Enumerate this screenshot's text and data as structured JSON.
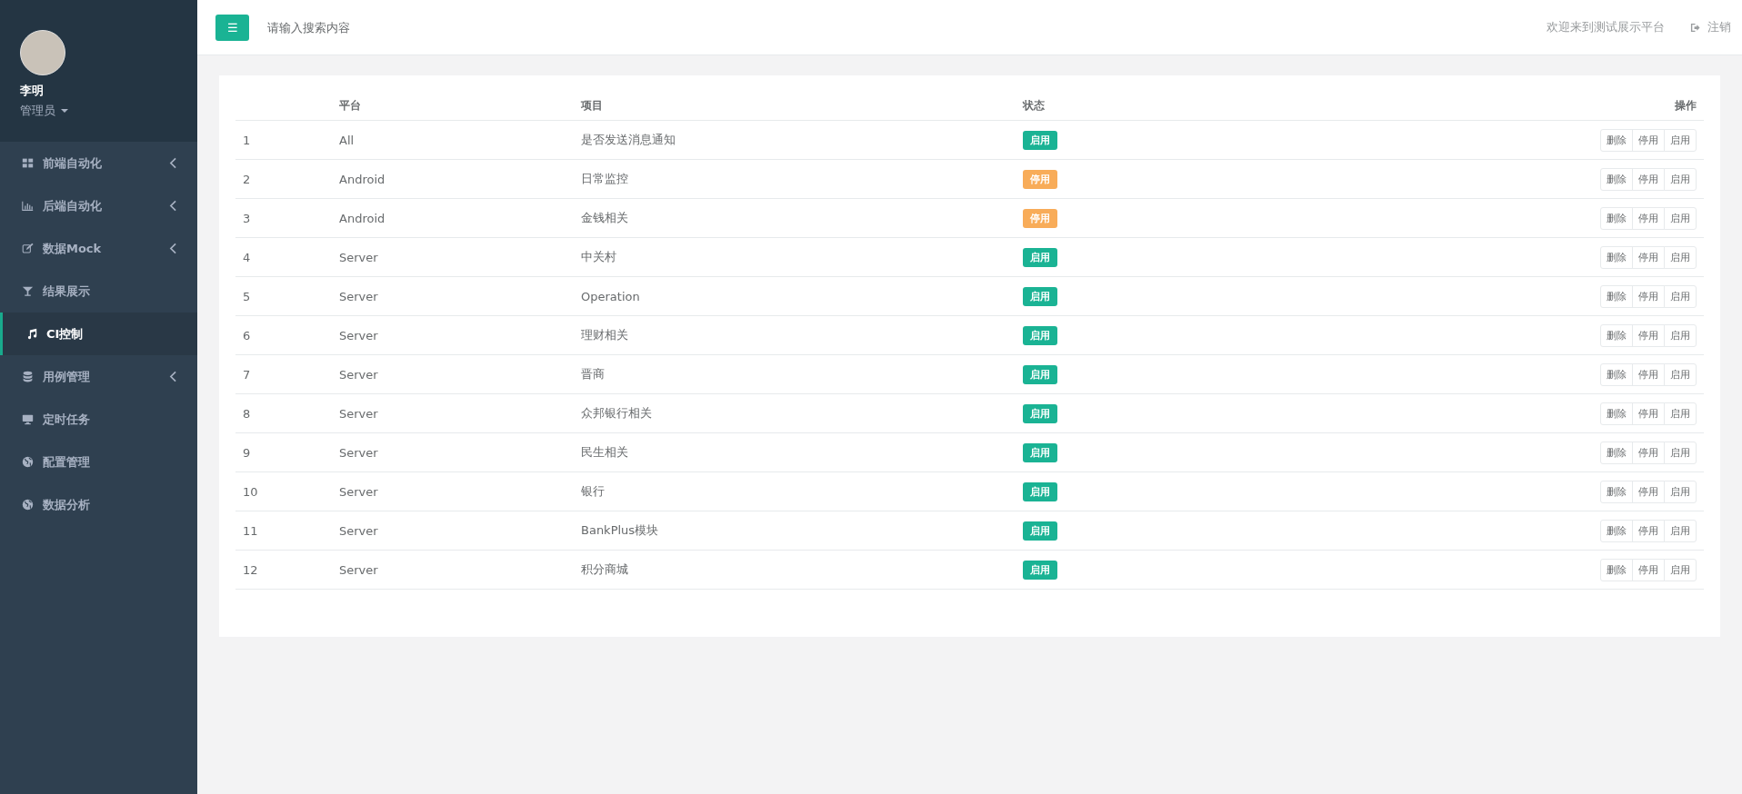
{
  "profile": {
    "name": "李明",
    "role": "管理员"
  },
  "sidebar": {
    "items": [
      {
        "label": "前端自动化",
        "submenu": true,
        "selected": false
      },
      {
        "label": "后端自动化",
        "submenu": true,
        "selected": false
      },
      {
        "label": "数据Mock",
        "submenu": true,
        "selected": false
      },
      {
        "label": "结果展示",
        "submenu": false,
        "selected": false
      },
      {
        "label": "CI控制",
        "submenu": false,
        "selected": true
      },
      {
        "label": "用例管理",
        "submenu": true,
        "selected": false
      },
      {
        "label": "定时任务",
        "submenu": false,
        "selected": false
      },
      {
        "label": "配置管理",
        "submenu": false,
        "selected": false
      },
      {
        "label": "数据分析",
        "submenu": false,
        "selected": false
      }
    ]
  },
  "topbar": {
    "menu_icon": "☰",
    "search": {
      "placeholder": "请输入搜索内容"
    },
    "welcome": "欢迎来到测试展示平台",
    "logout": "注销"
  },
  "table": {
    "columns": [
      "平台",
      "项目",
      "状态",
      "操作"
    ],
    "rows": [
      {
        "index": "1",
        "platform": "All",
        "project": "是否发送消息通知",
        "status": {
          "label": "启用",
          "kind": "enabled"
        },
        "actions": [
          "删除",
          "停用",
          "启用"
        ]
      },
      {
        "index": "2",
        "platform": "Android",
        "project": "日常监控",
        "status": {
          "label": "停用",
          "kind": "disabled"
        },
        "actions": [
          "删除",
          "停用",
          "启用"
        ]
      },
      {
        "index": "3",
        "platform": "Android",
        "project": "金钱相关",
        "status": {
          "label": "停用",
          "kind": "disabled"
        },
        "actions": [
          "删除",
          "停用",
          "启用"
        ]
      },
      {
        "index": "4",
        "platform": "Server",
        "project": "中关村",
        "status": {
          "label": "启用",
          "kind": "enabled"
        },
        "actions": [
          "删除",
          "停用",
          "启用"
        ]
      },
      {
        "index": "5",
        "platform": "Server",
        "project": "Operation",
        "status": {
          "label": "启用",
          "kind": "enabled"
        },
        "actions": [
          "删除",
          "停用",
          "启用"
        ]
      },
      {
        "index": "6",
        "platform": "Server",
        "project": "理财相关",
        "status": {
          "label": "启用",
          "kind": "enabled"
        },
        "actions": [
          "删除",
          "停用",
          "启用"
        ]
      },
      {
        "index": "7",
        "platform": "Server",
        "project": "晋商",
        "status": {
          "label": "启用",
          "kind": "enabled"
        },
        "actions": [
          "删除",
          "停用",
          "启用"
        ]
      },
      {
        "index": "8",
        "platform": "Server",
        "project": "众邦银行相关",
        "status": {
          "label": "启用",
          "kind": "enabled"
        },
        "actions": [
          "删除",
          "停用",
          "启用"
        ]
      },
      {
        "index": "9",
        "platform": "Server",
        "project": "民生相关",
        "status": {
          "label": "启用",
          "kind": "enabled"
        },
        "actions": [
          "删除",
          "停用",
          "启用"
        ]
      },
      {
        "index": "10",
        "platform": "Server",
        "project": "银行",
        "status": {
          "label": "启用",
          "kind": "enabled"
        },
        "actions": [
          "删除",
          "停用",
          "启用"
        ]
      },
      {
        "index": "11",
        "platform": "Server",
        "project": "BankPlus模块",
        "status": {
          "label": "启用",
          "kind": "enabled"
        },
        "actions": [
          "删除",
          "停用",
          "启用"
        ]
      },
      {
        "index": "12",
        "platform": "Server",
        "project": "积分商城",
        "status": {
          "label": "启用",
          "kind": "enabled"
        },
        "actions": [
          "删除",
          "停用",
          "启用"
        ]
      }
    ]
  }
}
